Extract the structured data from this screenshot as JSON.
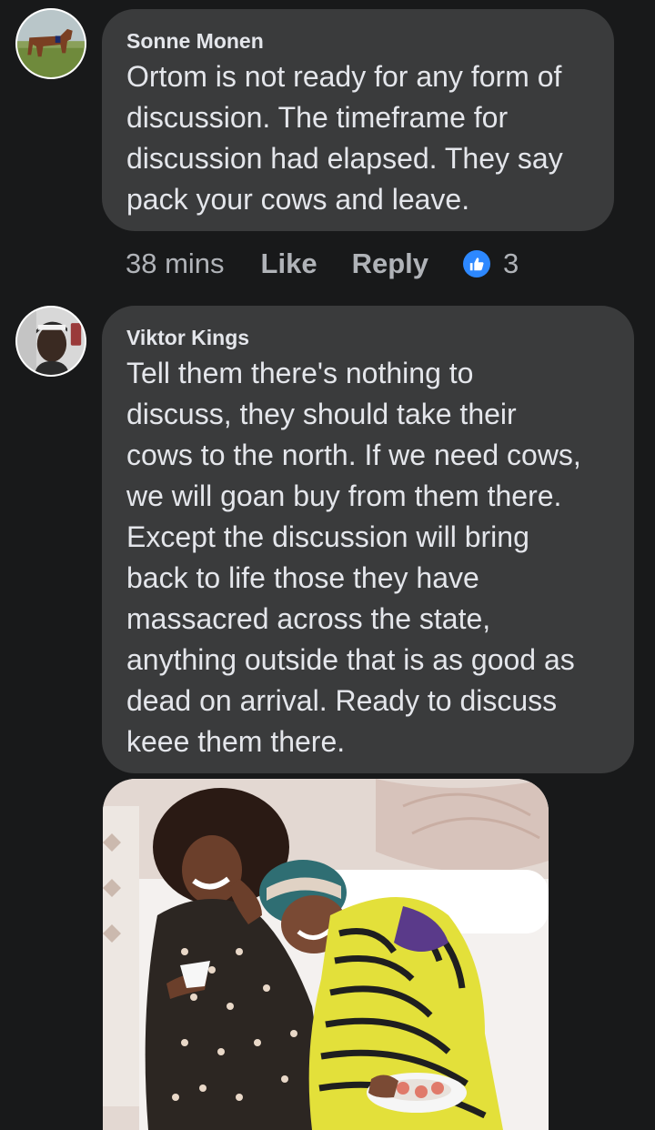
{
  "comments": [
    {
      "author": "Sonne Monen",
      "text": "Ortom is not ready for any form of\ndiscussion. The timeframe for\ndiscussion had elapsed. They say\npack your cows and leave.",
      "time": "38 mins",
      "like_label": "Like",
      "reply_label": "Reply",
      "reaction_count": "3",
      "avatar_icon": "horse-photo-avatar"
    },
    {
      "author": "Viktor Kings",
      "text": "Tell them there's nothing to\ndiscuss, they should take their\ncows to the north. If we need cows,\nwe will goan buy from them there.\nExcept the discussion will bring\nback to life those they have\nmassacred across the state,\nanything outside that is as good as\ndead on arrival. Ready to discuss\nkeee them there.",
      "avatar_icon": "person-photo-avatar",
      "attachment_icon": "laughing-women-photo"
    }
  ],
  "colors": {
    "background": "#18191a",
    "bubble": "#3a3b3c",
    "text": "#e4e6eb",
    "meta": "#b0b3b8",
    "like_blue": "#2d88ff"
  }
}
